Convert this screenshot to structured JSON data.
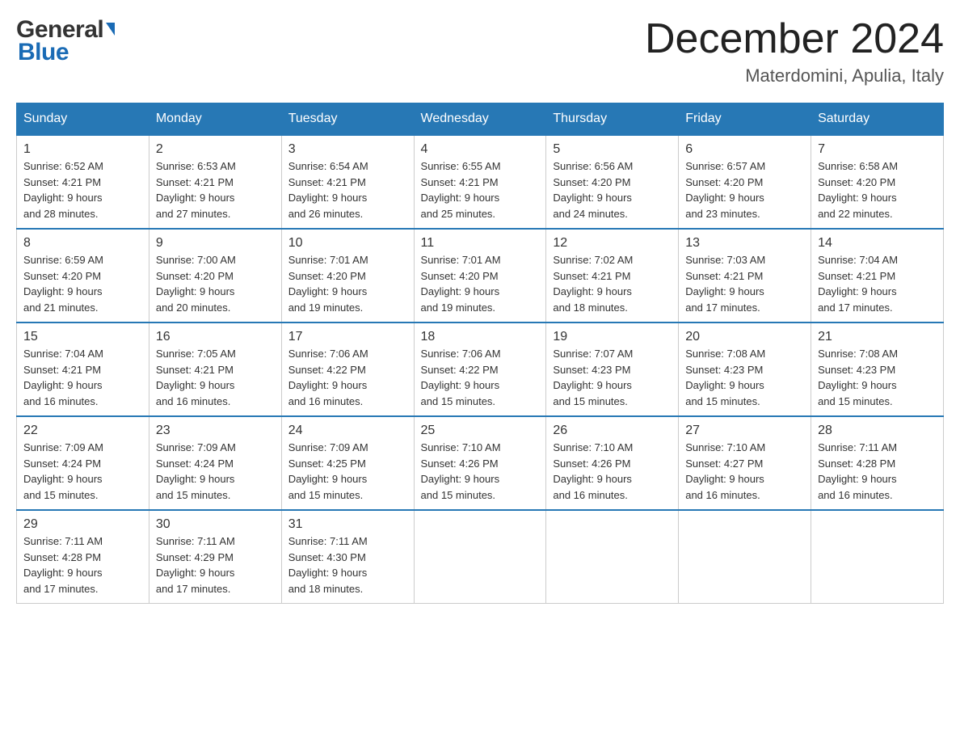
{
  "logo": {
    "text_general": "General",
    "text_blue": "Blue"
  },
  "title": {
    "month_year": "December 2024",
    "location": "Materdomini, Apulia, Italy"
  },
  "days_of_week": [
    "Sunday",
    "Monday",
    "Tuesday",
    "Wednesday",
    "Thursday",
    "Friday",
    "Saturday"
  ],
  "weeks": [
    [
      {
        "day": "1",
        "sunrise": "6:52 AM",
        "sunset": "4:21 PM",
        "daylight": "9 hours and 28 minutes."
      },
      {
        "day": "2",
        "sunrise": "6:53 AM",
        "sunset": "4:21 PM",
        "daylight": "9 hours and 27 minutes."
      },
      {
        "day": "3",
        "sunrise": "6:54 AM",
        "sunset": "4:21 PM",
        "daylight": "9 hours and 26 minutes."
      },
      {
        "day": "4",
        "sunrise": "6:55 AM",
        "sunset": "4:21 PM",
        "daylight": "9 hours and 25 minutes."
      },
      {
        "day": "5",
        "sunrise": "6:56 AM",
        "sunset": "4:20 PM",
        "daylight": "9 hours and 24 minutes."
      },
      {
        "day": "6",
        "sunrise": "6:57 AM",
        "sunset": "4:20 PM",
        "daylight": "9 hours and 23 minutes."
      },
      {
        "day": "7",
        "sunrise": "6:58 AM",
        "sunset": "4:20 PM",
        "daylight": "9 hours and 22 minutes."
      }
    ],
    [
      {
        "day": "8",
        "sunrise": "6:59 AM",
        "sunset": "4:20 PM",
        "daylight": "9 hours and 21 minutes."
      },
      {
        "day": "9",
        "sunrise": "7:00 AM",
        "sunset": "4:20 PM",
        "daylight": "9 hours and 20 minutes."
      },
      {
        "day": "10",
        "sunrise": "7:01 AM",
        "sunset": "4:20 PM",
        "daylight": "9 hours and 19 minutes."
      },
      {
        "day": "11",
        "sunrise": "7:01 AM",
        "sunset": "4:20 PM",
        "daylight": "9 hours and 19 minutes."
      },
      {
        "day": "12",
        "sunrise": "7:02 AM",
        "sunset": "4:21 PM",
        "daylight": "9 hours and 18 minutes."
      },
      {
        "day": "13",
        "sunrise": "7:03 AM",
        "sunset": "4:21 PM",
        "daylight": "9 hours and 17 minutes."
      },
      {
        "day": "14",
        "sunrise": "7:04 AM",
        "sunset": "4:21 PM",
        "daylight": "9 hours and 17 minutes."
      }
    ],
    [
      {
        "day": "15",
        "sunrise": "7:04 AM",
        "sunset": "4:21 PM",
        "daylight": "9 hours and 16 minutes."
      },
      {
        "day": "16",
        "sunrise": "7:05 AM",
        "sunset": "4:21 PM",
        "daylight": "9 hours and 16 minutes."
      },
      {
        "day": "17",
        "sunrise": "7:06 AM",
        "sunset": "4:22 PM",
        "daylight": "9 hours and 16 minutes."
      },
      {
        "day": "18",
        "sunrise": "7:06 AM",
        "sunset": "4:22 PM",
        "daylight": "9 hours and 15 minutes."
      },
      {
        "day": "19",
        "sunrise": "7:07 AM",
        "sunset": "4:23 PM",
        "daylight": "9 hours and 15 minutes."
      },
      {
        "day": "20",
        "sunrise": "7:08 AM",
        "sunset": "4:23 PM",
        "daylight": "9 hours and 15 minutes."
      },
      {
        "day": "21",
        "sunrise": "7:08 AM",
        "sunset": "4:23 PM",
        "daylight": "9 hours and 15 minutes."
      }
    ],
    [
      {
        "day": "22",
        "sunrise": "7:09 AM",
        "sunset": "4:24 PM",
        "daylight": "9 hours and 15 minutes."
      },
      {
        "day": "23",
        "sunrise": "7:09 AM",
        "sunset": "4:24 PM",
        "daylight": "9 hours and 15 minutes."
      },
      {
        "day": "24",
        "sunrise": "7:09 AM",
        "sunset": "4:25 PM",
        "daylight": "9 hours and 15 minutes."
      },
      {
        "day": "25",
        "sunrise": "7:10 AM",
        "sunset": "4:26 PM",
        "daylight": "9 hours and 15 minutes."
      },
      {
        "day": "26",
        "sunrise": "7:10 AM",
        "sunset": "4:26 PM",
        "daylight": "9 hours and 16 minutes."
      },
      {
        "day": "27",
        "sunrise": "7:10 AM",
        "sunset": "4:27 PM",
        "daylight": "9 hours and 16 minutes."
      },
      {
        "day": "28",
        "sunrise": "7:11 AM",
        "sunset": "4:28 PM",
        "daylight": "9 hours and 16 minutes."
      }
    ],
    [
      {
        "day": "29",
        "sunrise": "7:11 AM",
        "sunset": "4:28 PM",
        "daylight": "9 hours and 17 minutes."
      },
      {
        "day": "30",
        "sunrise": "7:11 AM",
        "sunset": "4:29 PM",
        "daylight": "9 hours and 17 minutes."
      },
      {
        "day": "31",
        "sunrise": "7:11 AM",
        "sunset": "4:30 PM",
        "daylight": "9 hours and 18 minutes."
      },
      null,
      null,
      null,
      null
    ]
  ],
  "labels": {
    "sunrise": "Sunrise:",
    "sunset": "Sunset:",
    "daylight": "Daylight:"
  }
}
